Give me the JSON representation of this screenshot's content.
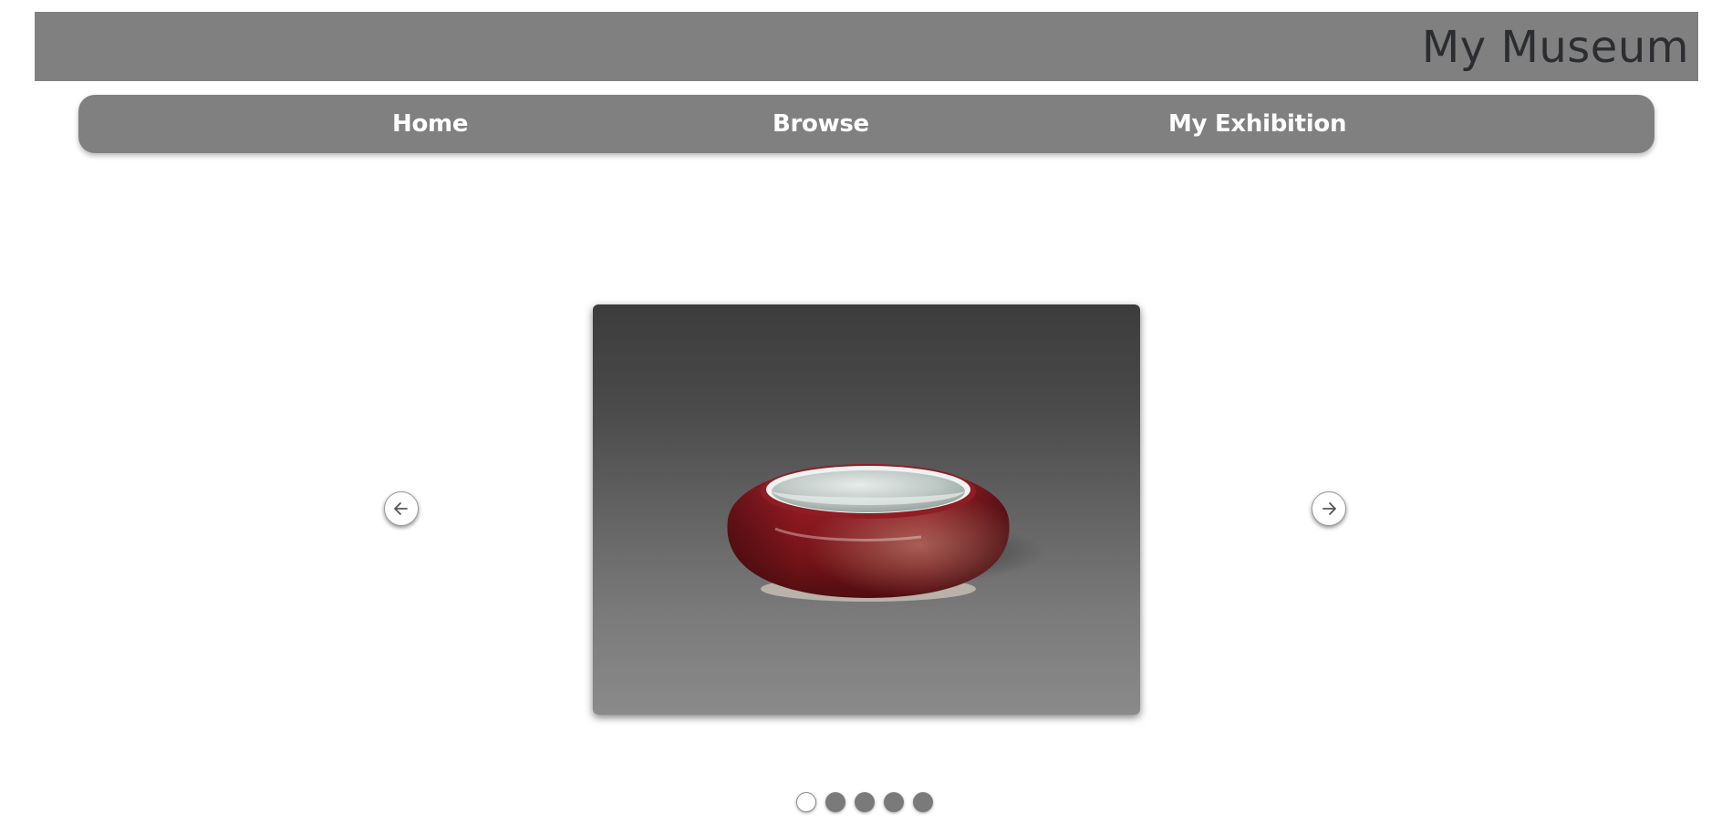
{
  "header": {
    "site_title": "My Museum",
    "background_color": "#808080",
    "title_color": "#2b2d31"
  },
  "nav": {
    "items": [
      {
        "label": "Home"
      },
      {
        "label": "Browse"
      },
      {
        "label": "My Exhibition"
      }
    ],
    "background_color": "#808080",
    "text_color": "#ffffff"
  },
  "carousel": {
    "current_image": {
      "alt": "Red glazed porcelain brush washer on gray background",
      "subject": "bowl",
      "glaze_color": "#8e1b22"
    },
    "prev_icon": "arrow-left-icon",
    "next_icon": "arrow-right-icon",
    "slide_count": 5,
    "active_index": 0,
    "indicator_active_color": "#ffffff",
    "indicator_inactive_color": "#7a7a7a"
  }
}
